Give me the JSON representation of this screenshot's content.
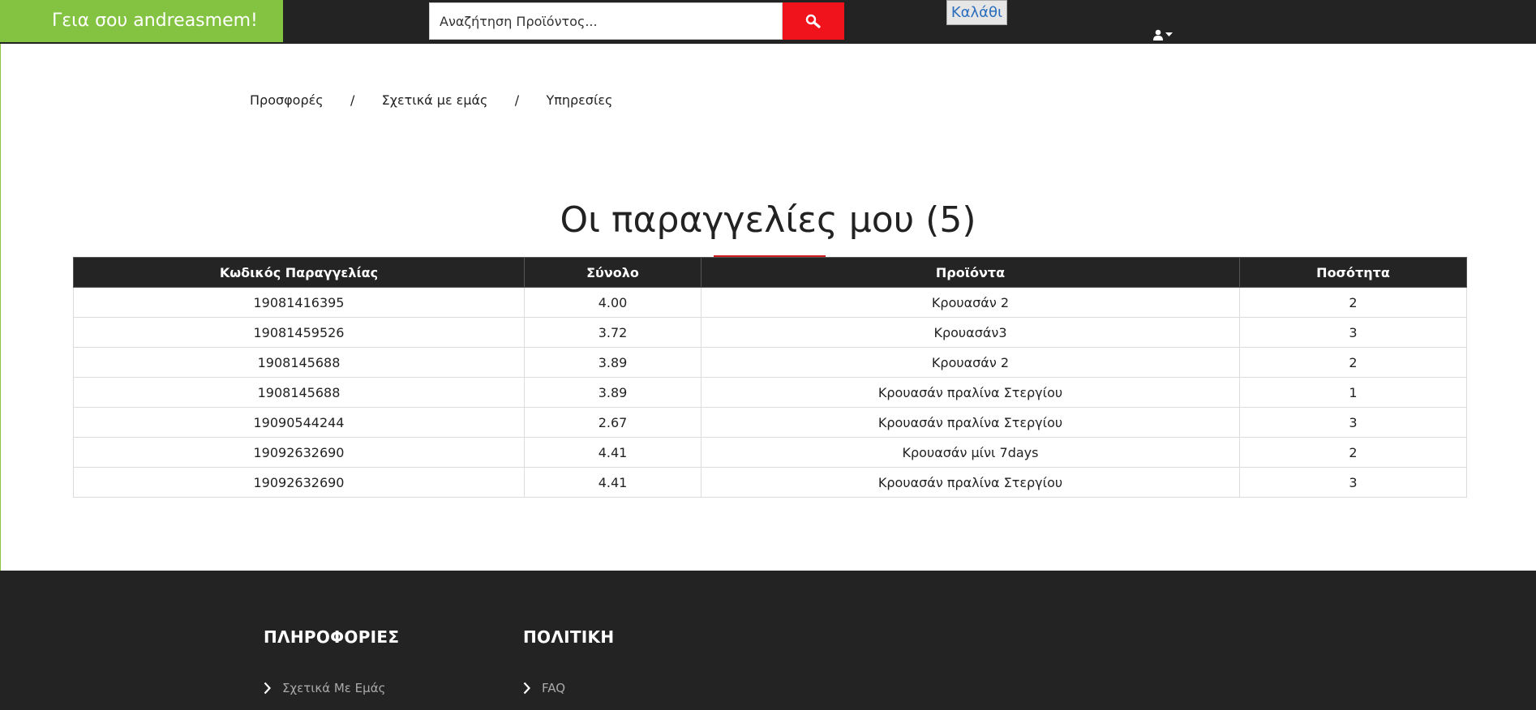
{
  "header": {
    "greeting": "Γεια σου andreasmem!",
    "search_placeholder": "Αναζήτηση Προϊόντος...",
    "cart_label": "Καλάθι"
  },
  "breadcrumb": {
    "items": [
      "Προσφορές",
      "Σχετικά με εμάς",
      "Υπηρεσίες"
    ],
    "separator": "/"
  },
  "page": {
    "title": "Οι παραγγελίες μου (5)"
  },
  "orders_table": {
    "columns": [
      "Κωδικός Παραγγελίας",
      "Σύνολο",
      "Προϊόντα",
      "Ποσότητα"
    ],
    "rows": [
      [
        "19081416395",
        "4.00",
        "Κρουασάν 2",
        "2"
      ],
      [
        "19081459526",
        "3.72",
        "Κρουασάν3",
        "3"
      ],
      [
        "1908145688",
        "3.89",
        "Κρουασάν 2",
        "2"
      ],
      [
        "1908145688",
        "3.89",
        "Κρουασάν πραλίνα Στεργίου",
        "1"
      ],
      [
        "19090544244",
        "2.67",
        "Κρουασάν πραλίνα Στεργίου",
        "3"
      ],
      [
        "19092632690",
        "4.41",
        "Κρουασάν μίνι 7days",
        "2"
      ],
      [
        "19092632690",
        "4.41",
        "Κρουασάν πραλίνα Στεργίου",
        "3"
      ]
    ]
  },
  "footer": {
    "info_heading": "ΠΛΗΡΟΦΟΡΙΕΣ",
    "info_link": "Σχετικά Με Εμάς",
    "policy_heading": "ΠΟΛΙΤΙΚΗ",
    "policy_link": "FAQ"
  },
  "colors": {
    "greeting_bg": "#84c341",
    "topbar_bg": "#232323",
    "search_button": "#f0131b",
    "title_underline": "#d31a1a",
    "cart_text": "#2a6ebd"
  },
  "icons": {
    "search": "search-icon",
    "user": "user-icon",
    "dropdown": "caret-down-icon",
    "footer_link": "chevron-right-icon"
  }
}
